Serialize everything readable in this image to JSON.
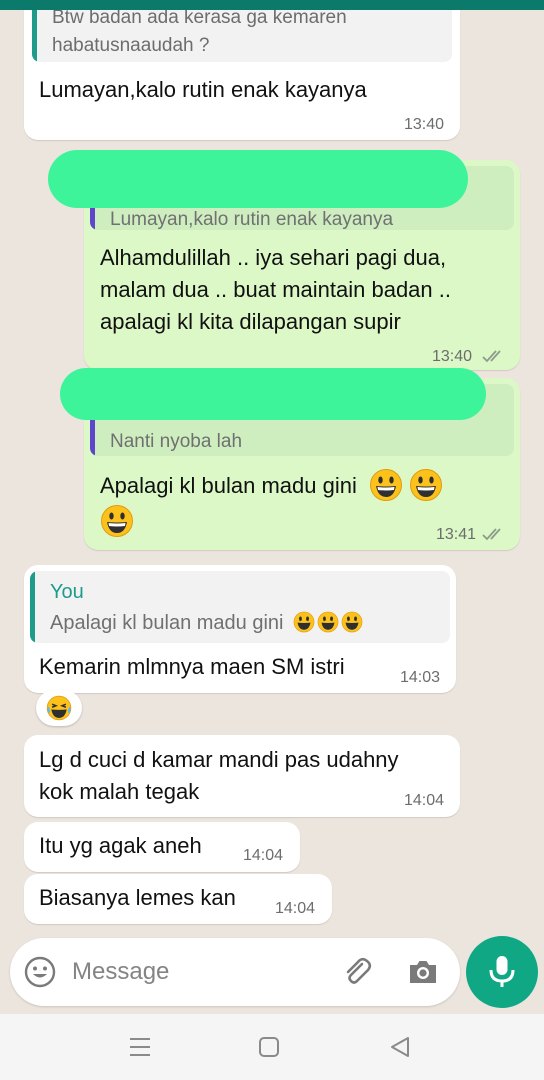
{
  "messages": {
    "m1": {
      "quote_text_1": "Btw badan ada kerasa ga kemaren",
      "quote_text_2": "habatusnaaudah ?",
      "text": "Lumayan,kalo rutin enak kayanya",
      "time": "13:40"
    },
    "m2": {
      "quote_text": "Lumayan,kalo rutin enak kayanya",
      "line1": "Alhamdulillah .. iya sehari pagi dua,",
      "line2": "malam dua .. buat maintain badan ..",
      "line3": "apalagi kl kita dilapangan supir",
      "time": "13:40"
    },
    "m3": {
      "quote_text": "Nanti nyoba lah",
      "text": "Apalagi kl bulan madu gini",
      "time": "13:41"
    },
    "m4": {
      "quote_author": "You",
      "quote_text": "Apalagi kl bulan madu gini",
      "text": "Kemarin mlmnya maen SM istri",
      "time": "14:03"
    },
    "m5": {
      "line1": "Lg d cuci d kamar mandi pas udahny",
      "line2": "kok malah tegak",
      "time": "14:04"
    },
    "m6": {
      "text": "Itu yg agak aneh",
      "time": "14:04"
    },
    "m7": {
      "text": "Biasanya lemes kan",
      "time": "14:04"
    }
  },
  "input": {
    "placeholder": "Message"
  },
  "colors": {
    "background": "#ece5dd",
    "incoming": "#ffffff",
    "outgoing": "#dcf8c6",
    "accent": "#10a884",
    "redaction": "#3ef49a",
    "quote_bar": "#5b47c8",
    "quote_bar_you": "#1f9b8b"
  },
  "icons": [
    "emoji-icon",
    "attach-icon",
    "camera-icon",
    "mic-icon",
    "double-check-icon",
    "grinning-emoji",
    "laughing-emoji",
    "menu-nav-icon",
    "home-nav-icon",
    "back-nav-icon"
  ]
}
